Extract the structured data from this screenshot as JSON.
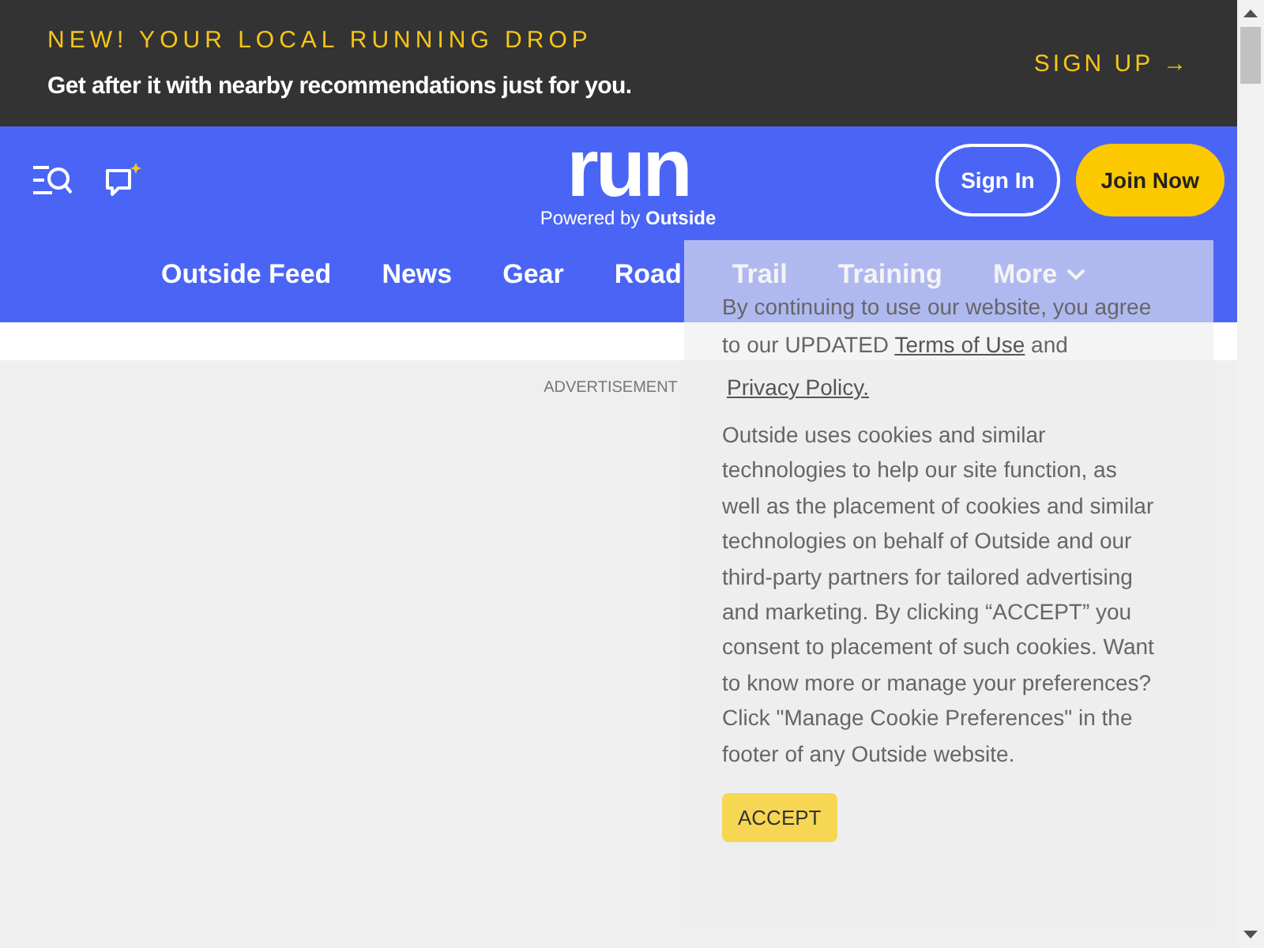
{
  "promo_banner": {
    "headline": "NEW! YOUR LOCAL RUNNING DROP",
    "subtext": "Get after it with nearby recommendations just for you.",
    "cta": "SIGN UP",
    "cta_arrow": "→"
  },
  "header": {
    "logo": {
      "wordmark": "run",
      "tagline": "Powered by **Outside**"
    },
    "sign_in": "Sign In",
    "join_now": "Join Now"
  },
  "nav": [
    {
      "label": "Outside Feed",
      "dropdown": false
    },
    {
      "label": "News",
      "dropdown": false
    },
    {
      "label": "Gear",
      "dropdown": false
    },
    {
      "label": "Road",
      "dropdown": false
    },
    {
      "label": "Trail",
      "dropdown": false
    },
    {
      "label": "Training",
      "dropdown": false
    },
    {
      "label": "More",
      "dropdown": true
    }
  ],
  "advertisement_label": "ADVERTISEMENT",
  "cookie_notice": {
    "intro": "By continuing to use our website, you agree to our UPDATED",
    "terms_link": "Terms of Use",
    "and_text": "and",
    "privacy_link": "Privacy Policy.",
    "body": "Outside uses cookies and similar technologies to help our site function, as well as the placement of cookies and similar technologies on behalf of Outside and our third-party partners for tailored advertising and marketing. By clicking “ACCEPT” you consent to placement of such cookies. Want to know more or manage your preferences? Click \"Manage Cookie Preferences\" in the footer of any Outside website.",
    "accept_button": "ACCEPT"
  }
}
